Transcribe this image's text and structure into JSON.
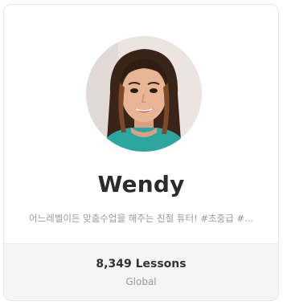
{
  "tutor_card": {
    "name": "Wendy",
    "tagline": "어느레벨이든 맞춤수업을 해주는 친절 튜터! #초중급 #...",
    "lessons": "8,349 Lessons",
    "region": "Global",
    "colors": {
      "name_text": "#2b2b2b",
      "muted_text": "#9a9a9a",
      "stats_background": "#f5f5f5",
      "border": "#e6e6e6"
    }
  }
}
